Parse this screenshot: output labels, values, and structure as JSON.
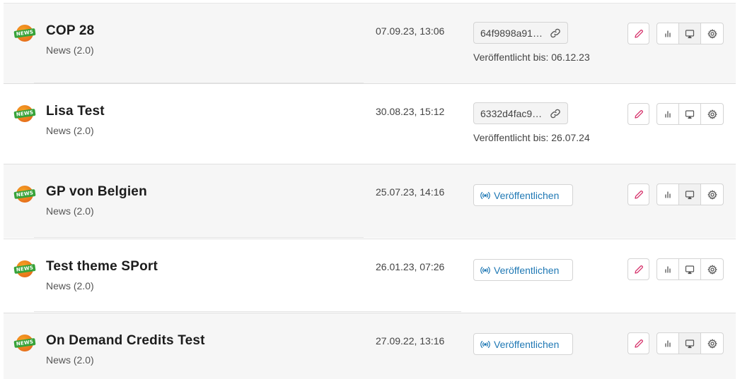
{
  "items": [
    {
      "title": "COP 28",
      "subtitle": "News (2.0)",
      "date": "07.09.23, 13:06",
      "hash": "64f9898a91…",
      "published_until": "Veröffentlicht bis: 06.12.23",
      "publish_label": ""
    },
    {
      "title": "Lisa Test",
      "subtitle": "News (2.0)",
      "date": "30.08.23, 15:12",
      "hash": "6332d4fac9…",
      "published_until": "Veröffentlicht bis: 26.07.24",
      "publish_label": ""
    },
    {
      "title": "GP von Belgien",
      "subtitle": "News (2.0)",
      "date": "25.07.23, 14:16",
      "hash": "",
      "published_until": "",
      "publish_label": "Veröffentlichen"
    },
    {
      "title": "Test theme SPort",
      "subtitle": "News (2.0)",
      "date": "26.01.23, 07:26",
      "hash": "",
      "published_until": "",
      "publish_label": "Veröffentlichen"
    },
    {
      "title": "On Demand Credits Test",
      "subtitle": "News (2.0)",
      "date": "27.09.22, 13:16",
      "hash": "",
      "published_until": "",
      "publish_label": "Veröffentlichen"
    }
  ],
  "badge_text": "NEWS",
  "colors": {
    "edit_icon": "#d6336c",
    "publish_text": "#1f78b4",
    "row_shade": "#f6f6f6"
  },
  "icons": {
    "edit": "pencil-icon",
    "stats": "bar-chart-icon",
    "preview": "screen-cast-icon",
    "settings": "gear-icon",
    "copy_link": "link-icon",
    "publish": "broadcast-icon"
  }
}
